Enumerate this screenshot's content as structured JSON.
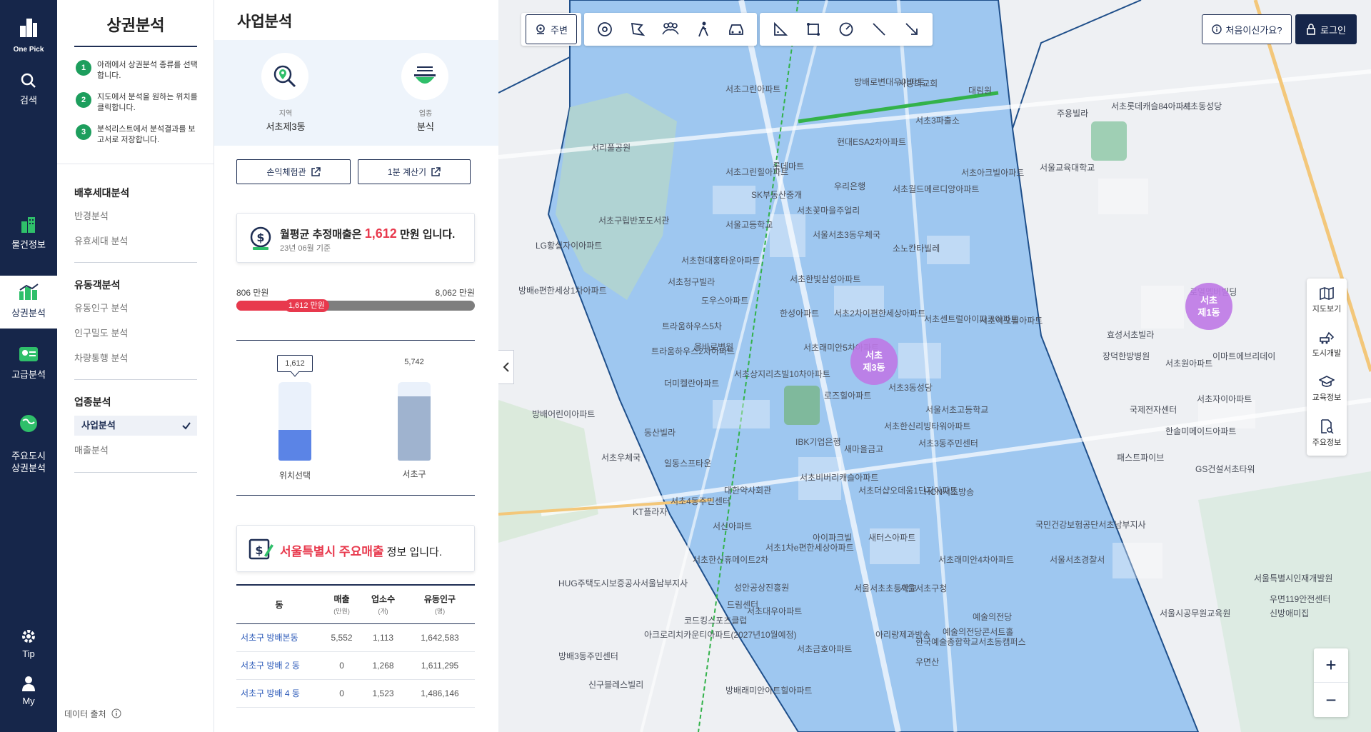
{
  "nav": {
    "logo": "One Pick",
    "items": [
      {
        "label": "검색"
      },
      {
        "label": "물건정보"
      },
      {
        "label": "상권분석"
      },
      {
        "label": "고급분석"
      },
      {
        "label": "주요도시\n상권분석"
      },
      {
        "label": "Tip"
      },
      {
        "label": "My"
      }
    ]
  },
  "steps": {
    "title": "상권분석",
    "items": [
      {
        "num": "1",
        "text": "아래에서 상권분석 종류를 선택합니다."
      },
      {
        "num": "2",
        "text": "지도에서 분석을 원하는 위치를 클릭합니다."
      },
      {
        "num": "3",
        "text": "분석리스트에서 분석결과를 보고서로 저장합니다."
      }
    ],
    "groups": [
      {
        "title": "배후세대분석",
        "items": [
          "반경분석",
          "유효세대 분석"
        ]
      },
      {
        "title": "유동객분석",
        "items": [
          "유동인구 분석",
          "인구밀도 분석",
          "차량통행 분석"
        ]
      },
      {
        "title": "업종분석",
        "items": [
          "사업분석",
          "매출분석"
        ]
      }
    ],
    "source": "데이터 출처"
  },
  "analysis": {
    "title": "사업분석",
    "region_label": "지역",
    "region_value": "서초제3동",
    "industry_label": "업종",
    "industry_value": "분식",
    "btn_profit": "손익체험관",
    "btn_calc": "1분 계산기",
    "sales_prefix": "월평균 추정매출은",
    "sales_value": "1,612",
    "sales_suffix": "만원 입니다.",
    "sales_date": "23년 06월 기준",
    "range_min": "806 만원",
    "range_max": "8,062 만원",
    "range_marker": "1,612 만원",
    "range_fraction": 0.11,
    "compare": [
      {
        "label": "위치선택",
        "value": "1,612",
        "fraction": 0.39,
        "color": "#5b84e6"
      },
      {
        "label": "서초구",
        "value": "5,742",
        "fraction": 0.82,
        "color": "#9fb3cf"
      }
    ],
    "major_highlight": "서울특별시 주요매출",
    "major_suffix": "정보 입니다.",
    "table": {
      "headers": [
        {
          "label": "동",
          "unit": ""
        },
        {
          "label": "매출",
          "unit": "(만원)"
        },
        {
          "label": "업소수",
          "unit": "(개)"
        },
        {
          "label": "유동인구",
          "unit": "(명)"
        }
      ],
      "rows": [
        [
          "서초구 방배본동",
          "5,552",
          "1,113",
          "1,642,583"
        ],
        [
          "서초구 방배 2 동",
          "0",
          "1,268",
          "1,611,295"
        ],
        [
          "서초구 방배 4 동",
          "0",
          "1,523",
          "1,486,146"
        ]
      ]
    }
  },
  "map": {
    "tool_first": "주변",
    "help": "처음이신가요?",
    "login": "로그인",
    "side_tools": [
      "지도보기",
      "도시개발",
      "교육정보",
      "주요정보"
    ],
    "pins": [
      "서초\n제3동",
      "서초\n제1동"
    ],
    "labels": [
      "서리풀공원",
      "서초구립반포도서관",
      "LG황실자이아파트",
      "방배e편한세상1차아파트",
      "서초그린힐아파트",
      "서울고등학교",
      "서초현대홍타운아파트",
      "서초청구빌라",
      "도우스아파트",
      "트라움하우스5차",
      "올바로병원",
      "트라움하우스2차아파트",
      "서초꽃마을주얼리",
      "서울서초3동우체국",
      "소노칸타빌레",
      "서초한빛삼성아파트",
      "서초2차이편한세상아파트",
      "한성아파트",
      "서초센트럴아이파크아파트",
      "서초이오빌아파트",
      "서초래미안5차아파트",
      "서초상지리츠빌10차아파트",
      "로즈힐아파트",
      "서초3동성당",
      "서울서초고등학교",
      "서초한신리빙타워아파트",
      "더미켈란아파트",
      "동산빌라",
      "IBK기업은행",
      "새마을금고",
      "서초3동주민센터",
      "일동스프타운",
      "대한약사회관",
      "서초비버리캐슬아파트",
      "서초더샵오데움1단지아파트",
      "HCN서초방송",
      "국민건강보험공단서초남부지사",
      "서신아파트",
      "아이파크빌",
      "서초1차e편한세상아파트",
      "새터스아파트",
      "서초래미안4차아파트",
      "현대ESA2차아파트",
      "서초3파출소",
      "우리은행",
      "서초월드메르디앙아파트",
      "서초아크빌아파트",
      "주용빌라",
      "서울교육대학교",
      "서초롯데캐슬84아파트",
      "서초동성당",
      "효성서초빌라",
      "장덕한방병원",
      "서초원아파트",
      "이마트에브리데이",
      "국제전자센터",
      "서초자이아파트",
      "한솔미메이드아파트",
      "패스트파이브",
      "GS건설서초타워",
      "서울서초경찰서",
      "예술의전당",
      "한국예술종합학교서초동캠퍼스",
      "우면산",
      "아리랑제과방송",
      "예술의전당콘서트홀",
      "서울서초구청",
      "서울서초초등학교",
      "서울특별시인재개발원",
      "서울시공무원교육원",
      "신방애미집",
      "우면119안전센터",
      "방배래미안아트힐아파트",
      "방배3동주민센터",
      "신구블레스빌리",
      "아크로리치카운티아파트(2027년10월예정)",
      "드림센터",
      "서초대우아파트",
      "서초금호아파트",
      "코드킹스포츠클럽",
      "KT플라자",
      "서초한신휴메이트2차",
      "성안공상진흥원",
      "방배로변대우아파트",
      "SK부동산중개",
      "롯데마트",
      "서초그린아파트",
      "사랑의교회",
      "대림원",
      "HUG주택도시보증공사서울남부지사",
      "로열멤버빌딩",
      "방배어린이아파트",
      "서초우체국",
      "서초4동주민센터"
    ]
  }
}
